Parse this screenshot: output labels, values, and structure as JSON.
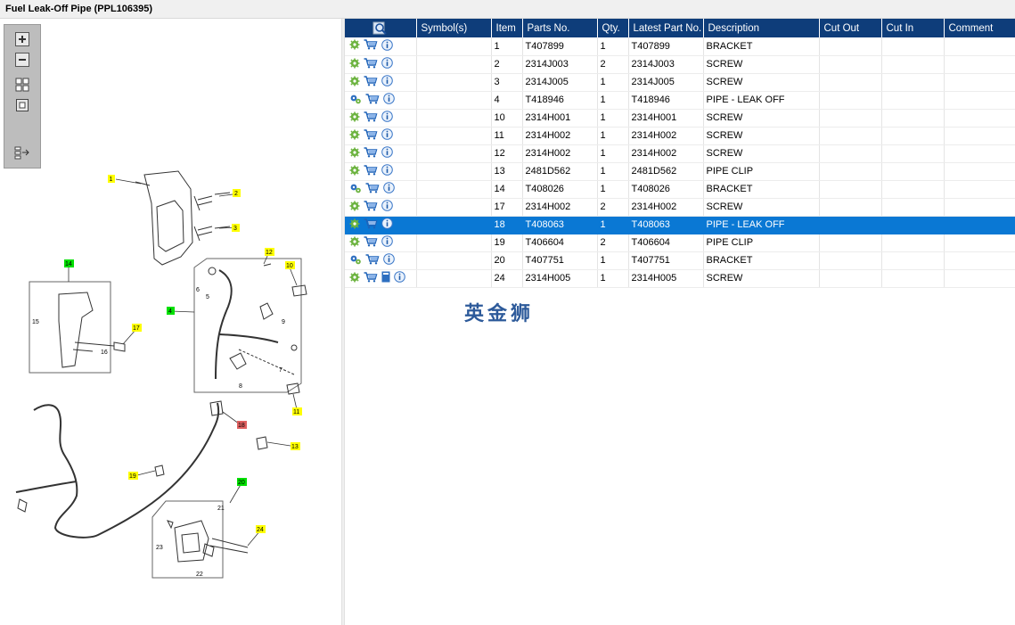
{
  "window": {
    "title": "Fuel Leak-Off Pipe (PPL106395)"
  },
  "toolbar": {
    "buttons": [
      {
        "icon": "zoom-in-icon"
      },
      {
        "icon": "zoom-out-icon"
      },
      {
        "icon": "fit-all-icon"
      },
      {
        "icon": "actual-size-icon"
      },
      {
        "icon": "layout-toggle-icon"
      }
    ]
  },
  "diagram": {
    "callouts": {
      "c1": "1",
      "c2": "2",
      "c3": "3",
      "c4": "4",
      "c5": "5",
      "c6": "6",
      "c7": "7",
      "c8": "8",
      "c9": "9",
      "c10": "10",
      "c11": "11",
      "c12": "12",
      "c13": "13",
      "c14": "14",
      "c15": "15",
      "c16": "16",
      "c17": "17",
      "c18": "18",
      "c19": "19",
      "c20": "20",
      "c21": "21",
      "c22": "22",
      "c23": "23",
      "c24": "24"
    }
  },
  "table": {
    "headers": [
      "Symbol(s)",
      "Item",
      "Parts No.",
      "Qty.",
      "Latest Part No.",
      "Description",
      "Cut Out",
      "Cut In",
      "Comment"
    ],
    "rows": [
      {
        "item": "1",
        "part_no": "T407899",
        "qty": "1",
        "latest": "T407899",
        "desc": "BRACKET",
        "cut_out": "",
        "cut_in": "",
        "comment": ""
      },
      {
        "item": "2",
        "part_no": "2314J003",
        "qty": "2",
        "latest": "2314J003",
        "desc": "SCREW",
        "cut_out": "",
        "cut_in": "",
        "comment": ""
      },
      {
        "item": "3",
        "part_no": "2314J005",
        "qty": "1",
        "latest": "2314J005",
        "desc": "SCREW",
        "cut_out": "",
        "cut_in": "",
        "comment": ""
      },
      {
        "item": "4",
        "part_no": "T418946",
        "qty": "1",
        "latest": "T418946",
        "desc": "PIPE - LEAK OFF",
        "cut_out": "",
        "cut_in": "",
        "comment": ""
      },
      {
        "item": "10",
        "part_no": "2314H001",
        "qty": "1",
        "latest": "2314H001",
        "desc": "SCREW",
        "cut_out": "",
        "cut_in": "",
        "comment": ""
      },
      {
        "item": "11",
        "part_no": "2314H002",
        "qty": "1",
        "latest": "2314H002",
        "desc": "SCREW",
        "cut_out": "",
        "cut_in": "",
        "comment": ""
      },
      {
        "item": "12",
        "part_no": "2314H002",
        "qty": "1",
        "latest": "2314H002",
        "desc": "SCREW",
        "cut_out": "",
        "cut_in": "",
        "comment": ""
      },
      {
        "item": "13",
        "part_no": "2481D562",
        "qty": "1",
        "latest": "2481D562",
        "desc": "PIPE CLIP",
        "cut_out": "",
        "cut_in": "",
        "comment": ""
      },
      {
        "item": "14",
        "part_no": "T408026",
        "qty": "1",
        "latest": "T408026",
        "desc": "BRACKET",
        "cut_out": "",
        "cut_in": "",
        "comment": ""
      },
      {
        "item": "17",
        "part_no": "2314H002",
        "qty": "2",
        "latest": "2314H002",
        "desc": "SCREW",
        "cut_out": "",
        "cut_in": "",
        "comment": ""
      },
      {
        "item": "18",
        "part_no": "T408063",
        "qty": "1",
        "latest": "T408063",
        "desc": "PIPE - LEAK OFF",
        "cut_out": "",
        "cut_in": "",
        "comment": ""
      },
      {
        "item": "19",
        "part_no": "T406604",
        "qty": "2",
        "latest": "T406604",
        "desc": "PIPE CLIP",
        "cut_out": "",
        "cut_in": "",
        "comment": ""
      },
      {
        "item": "20",
        "part_no": "T407751",
        "qty": "1",
        "latest": "T407751",
        "desc": "BRACKET",
        "cut_out": "",
        "cut_in": "",
        "comment": ""
      },
      {
        "item": "24",
        "part_no": "2314H005",
        "qty": "1",
        "latest": "2314H005",
        "desc": "SCREW",
        "cut_out": "",
        "cut_in": "",
        "comment": ""
      }
    ],
    "selected_item": "18"
  },
  "watermark": {
    "text": "英金狮"
  },
  "colors": {
    "header": "#0e3d7a",
    "selected": "#0a78d4",
    "callout_yellow": "#ffff00",
    "callout_green": "#00e000",
    "callout_red": "#e06060"
  }
}
